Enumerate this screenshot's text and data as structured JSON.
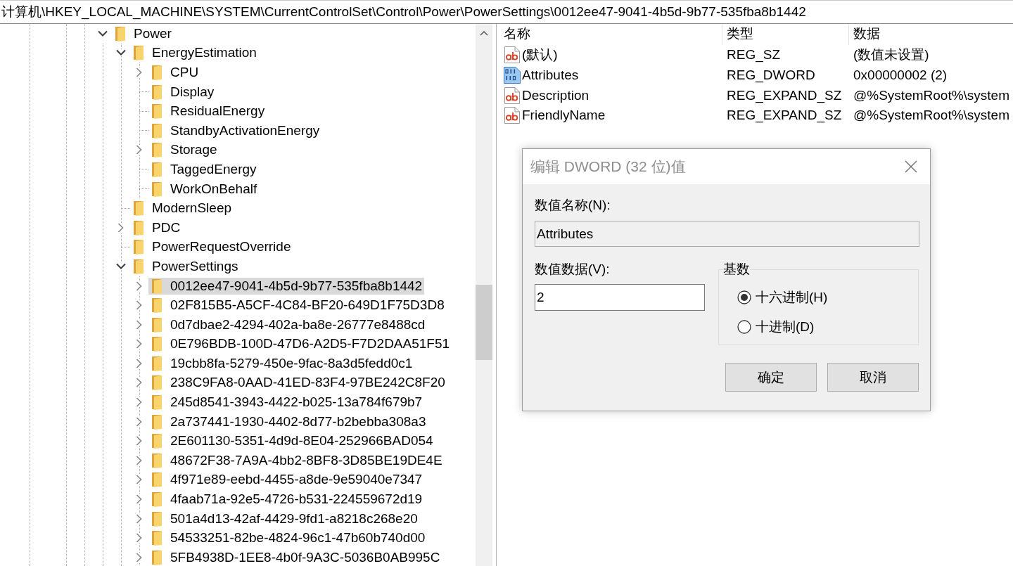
{
  "address_bar": {
    "path": "计算机\\HKEY_LOCAL_MACHINE\\SYSTEM\\CurrentControlSet\\Control\\Power\\PowerSettings\\0012ee47-9041-4b5d-9b77-535fba8b1442"
  },
  "tree": {
    "items": [
      {
        "label": "Power",
        "expanded": true,
        "selected": false,
        "children": [
          {
            "label": "EnergyEstimation",
            "expanded": true,
            "selected": false,
            "children": [
              {
                "label": "CPU",
                "expanded": false,
                "selected": false
              },
              {
                "label": "Display",
                "selected": false
              },
              {
                "label": "ResidualEnergy",
                "selected": false
              },
              {
                "label": "StandbyActivationEnergy",
                "selected": false
              },
              {
                "label": "Storage",
                "expanded": false,
                "selected": false
              },
              {
                "label": "TaggedEnergy",
                "selected": false
              },
              {
                "label": "WorkOnBehalf",
                "selected": false
              }
            ]
          },
          {
            "label": "ModernSleep",
            "selected": false
          },
          {
            "label": "PDC",
            "expanded": false,
            "selected": false
          },
          {
            "label": "PowerRequestOverride",
            "selected": false
          },
          {
            "label": "PowerSettings",
            "expanded": true,
            "selected": false,
            "children": [
              {
                "label": "0012ee47-9041-4b5d-9b77-535fba8b1442",
                "expanded": false,
                "selected": true
              },
              {
                "label": "02F815B5-A5CF-4C84-BF20-649D1F75D3D8",
                "expanded": false,
                "selected": false
              },
              {
                "label": "0d7dbae2-4294-402a-ba8e-26777e8488cd",
                "expanded": false,
                "selected": false
              },
              {
                "label": "0E796BDB-100D-47D6-A2D5-F7D2DAA51F51",
                "expanded": false,
                "selected": false
              },
              {
                "label": "19cbb8fa-5279-450e-9fac-8a3d5fedd0c1",
                "expanded": false,
                "selected": false
              },
              {
                "label": "238C9FA8-0AAD-41ED-83F4-97BE242C8F20",
                "expanded": false,
                "selected": false
              },
              {
                "label": "245d8541-3943-4422-b025-13a784f679b7",
                "expanded": false,
                "selected": false
              },
              {
                "label": "2a737441-1930-4402-8d77-b2bebba308a3",
                "expanded": false,
                "selected": false
              },
              {
                "label": "2E601130-5351-4d9d-8E04-252966BAD054",
                "expanded": false,
                "selected": false
              },
              {
                "label": "48672F38-7A9A-4bb2-8BF8-3D85BE19DE4E",
                "expanded": false,
                "selected": false
              },
              {
                "label": "4f971e89-eebd-4455-a8de-9e59040e7347",
                "expanded": false,
                "selected": false
              },
              {
                "label": "4faab71a-92e5-4726-b531-224559672d19",
                "expanded": false,
                "selected": false
              },
              {
                "label": "501a4d13-42af-4429-9fd1-a8218c268e20",
                "expanded": false,
                "selected": false
              },
              {
                "label": "54533251-82be-4824-96c1-47b60b740d00",
                "expanded": false,
                "selected": false
              },
              {
                "label": "5FB4938D-1EE8-4b0f-9A3C-5036B0AB995C",
                "expanded": false,
                "selected": false
              }
            ]
          }
        ]
      }
    ]
  },
  "values_list": {
    "columns": [
      "名称",
      "类型",
      "数据"
    ],
    "rows": [
      {
        "kind": "string",
        "name": "(默认)",
        "type": "REG_SZ",
        "data": "(数值未设置)"
      },
      {
        "kind": "binary",
        "name": "Attributes",
        "type": "REG_DWORD",
        "data": "0x00000002 (2)"
      },
      {
        "kind": "string",
        "name": "Description",
        "type": "REG_EXPAND_SZ",
        "data": "@%SystemRoot%\\system"
      },
      {
        "kind": "string",
        "name": "FriendlyName",
        "type": "REG_EXPAND_SZ",
        "data": "@%SystemRoot%\\system"
      }
    ]
  },
  "dialog": {
    "title": "编辑 DWORD (32 位)值",
    "name_label": "数值名称(N):",
    "name_field": {
      "value": "Attributes",
      "read_only": true
    },
    "data_label": "数值数据(V):",
    "data_field": {
      "value": "2",
      "read_only": false
    },
    "base_group": {
      "title": "基数",
      "options": [
        {
          "label": "十六进制(H)",
          "selected": true
        },
        {
          "label": "十进制(D)",
          "selected": false
        }
      ]
    },
    "buttons": [
      "确定",
      "取消"
    ]
  }
}
